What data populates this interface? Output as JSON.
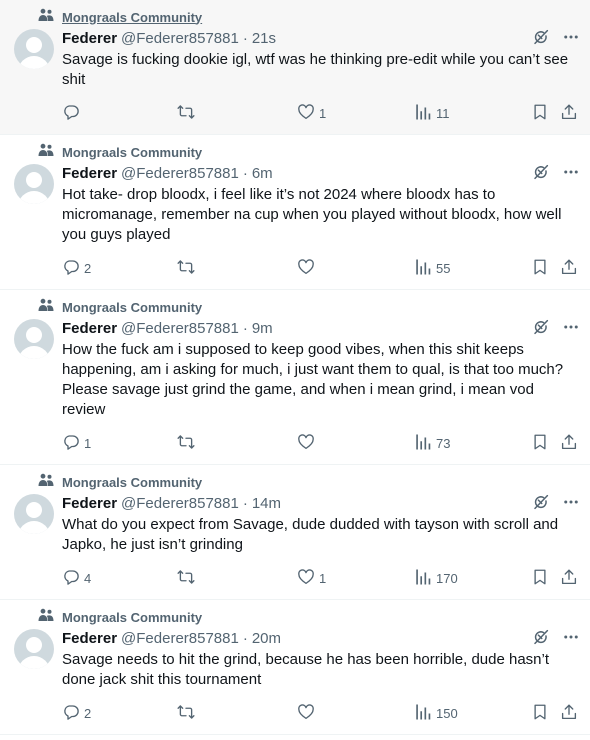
{
  "colors": {
    "muted": "#536471",
    "text": "#0f1419",
    "avatar_bg": "#cfd9de",
    "hover_bg": "#f7f7f7",
    "divider": "#eff3f4"
  },
  "icons": {
    "community": "community-icon",
    "grok": "grok-icon",
    "more": "more-icon",
    "reply": "reply-icon",
    "repost": "repost-icon",
    "like": "like-icon",
    "views": "views-icon",
    "bookmark": "bookmark-icon",
    "share": "share-icon"
  },
  "tweets": [
    {
      "community": "Mongraals Community",
      "name": "Federer",
      "handle": "@Federer857881",
      "separator": "·",
      "time": "21s",
      "text": "Savage is fucking dookie igl, wtf was he thinking pre-edit while you can’t see shit",
      "replies": "",
      "reposts": "",
      "likes": "1",
      "views": "11",
      "hovered": true
    },
    {
      "community": "Mongraals Community",
      "name": "Federer",
      "handle": "@Federer857881",
      "separator": "·",
      "time": "6m",
      "text": "Hot take- drop bloodx, i feel like it’s not 2024 where bloodx has to micromanage, remember na cup when you played without bloodx, how well you guys played",
      "replies": "2",
      "reposts": "",
      "likes": "",
      "views": "55",
      "hovered": false
    },
    {
      "community": "Mongraals Community",
      "name": "Federer",
      "handle": "@Federer857881",
      "separator": "·",
      "time": "9m",
      "text": "How the fuck am i supposed to keep good vibes, when this shit keeps happening, am i asking for much, i just want them to qual, is that too much? Please savage just grind the game, and when i mean grind, i mean vod review",
      "replies": "1",
      "reposts": "",
      "likes": "",
      "views": "73",
      "hovered": false
    },
    {
      "community": "Mongraals Community",
      "name": "Federer",
      "handle": "@Federer857881",
      "separator": "·",
      "time": "14m",
      "text": "What do you expect from Savage, dude dudded with tayson with scroll and Japko, he just isn’t grinding",
      "replies": "4",
      "reposts": "",
      "likes": "1",
      "views": "170",
      "hovered": false
    },
    {
      "community": "Mongraals Community",
      "name": "Federer",
      "handle": "@Federer857881",
      "separator": "·",
      "time": "20m",
      "text": "Savage needs to hit the grind, because he has been horrible, dude hasn’t done jack shit this tournament",
      "replies": "2",
      "reposts": "",
      "likes": "",
      "views": "150",
      "hovered": false
    }
  ]
}
